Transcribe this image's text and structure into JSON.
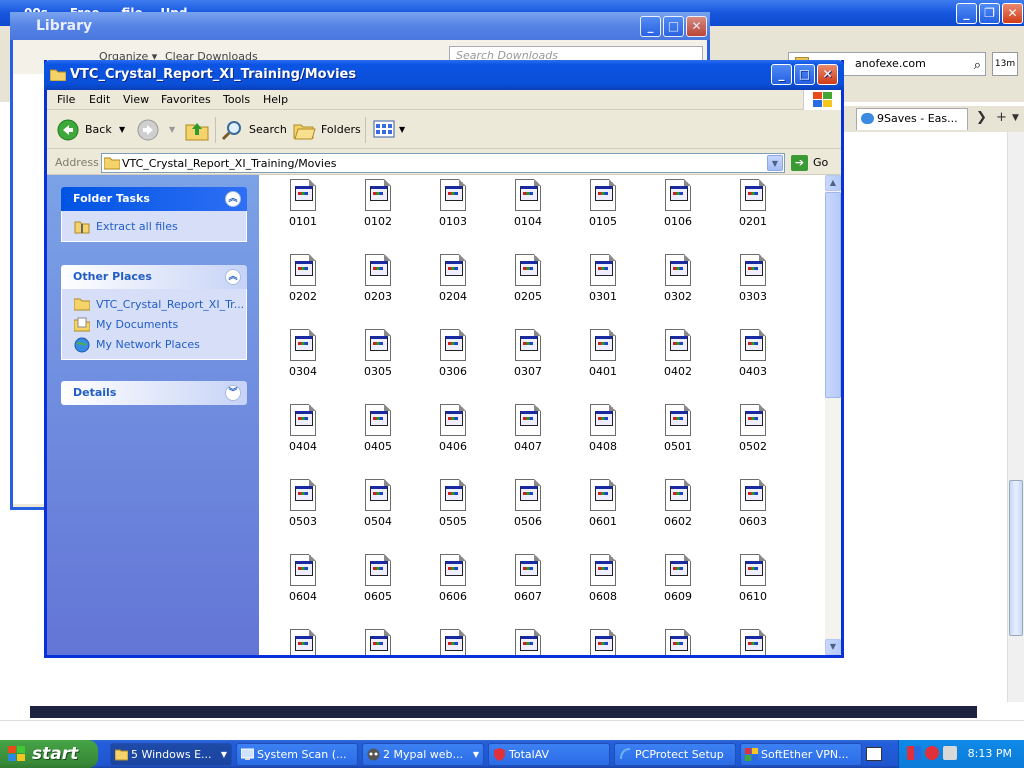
{
  "background_browser": {
    "title": "00s  ...  Free              ...     file...   Upd...",
    "url_text": "anofexe.com",
    "timer_text": "13m",
    "tab_label": "9Saves - Eas..."
  },
  "library_window": {
    "title": "Library",
    "organize_label": "Organize ▾",
    "clear_downloads_label": "Clear Downloads",
    "search_placeholder": "Search Downloads"
  },
  "explorer": {
    "title": "VTC_Crystal_Report_XI_Training/Movies",
    "menu": [
      "File",
      "Edit",
      "View",
      "Favorites",
      "Tools",
      "Help"
    ],
    "toolbar": {
      "back": "Back",
      "search": "Search",
      "folders": "Folders"
    },
    "address": {
      "label": "Address",
      "path": "VTC_Crystal_Report_XI_Training/Movies",
      "go": "Go"
    },
    "task_pane": {
      "folder_tasks": {
        "title": "Folder Tasks",
        "items": [
          "Extract all files"
        ]
      },
      "other_places": {
        "title": "Other Places",
        "items": [
          "VTC_Crystal_Report_XI_Tr...",
          "My Documents",
          "My Network Places"
        ]
      },
      "details": {
        "title": "Details"
      }
    },
    "files": [
      "0101",
      "0102",
      "0103",
      "0104",
      "0105",
      "0106",
      "0201",
      "0202",
      "0203",
      "0204",
      "0205",
      "0301",
      "0302",
      "0303",
      "0304",
      "0305",
      "0306",
      "0307",
      "0401",
      "0402",
      "0403",
      "0404",
      "0405",
      "0406",
      "0407",
      "0408",
      "0501",
      "0502",
      "0503",
      "0504",
      "0505",
      "0506",
      "0601",
      "0602",
      "0603",
      "0604",
      "0605",
      "0606",
      "0607",
      "0608",
      "0609",
      "0610",
      "",
      "",
      "",
      "",
      "",
      "",
      ""
    ]
  },
  "taskbar": {
    "start": "start",
    "tasks": [
      "5 Windows E...",
      "System Scan (...",
      "2 Mypal web...",
      "TotalAV",
      "PCProtect Setup",
      "SoftEther VPN..."
    ],
    "clock": "8:13 PM"
  },
  "colors": {
    "xp_blue": "#0a4fd8",
    "task_pane_blue": "#6375d6",
    "start_green": "#388a38"
  }
}
